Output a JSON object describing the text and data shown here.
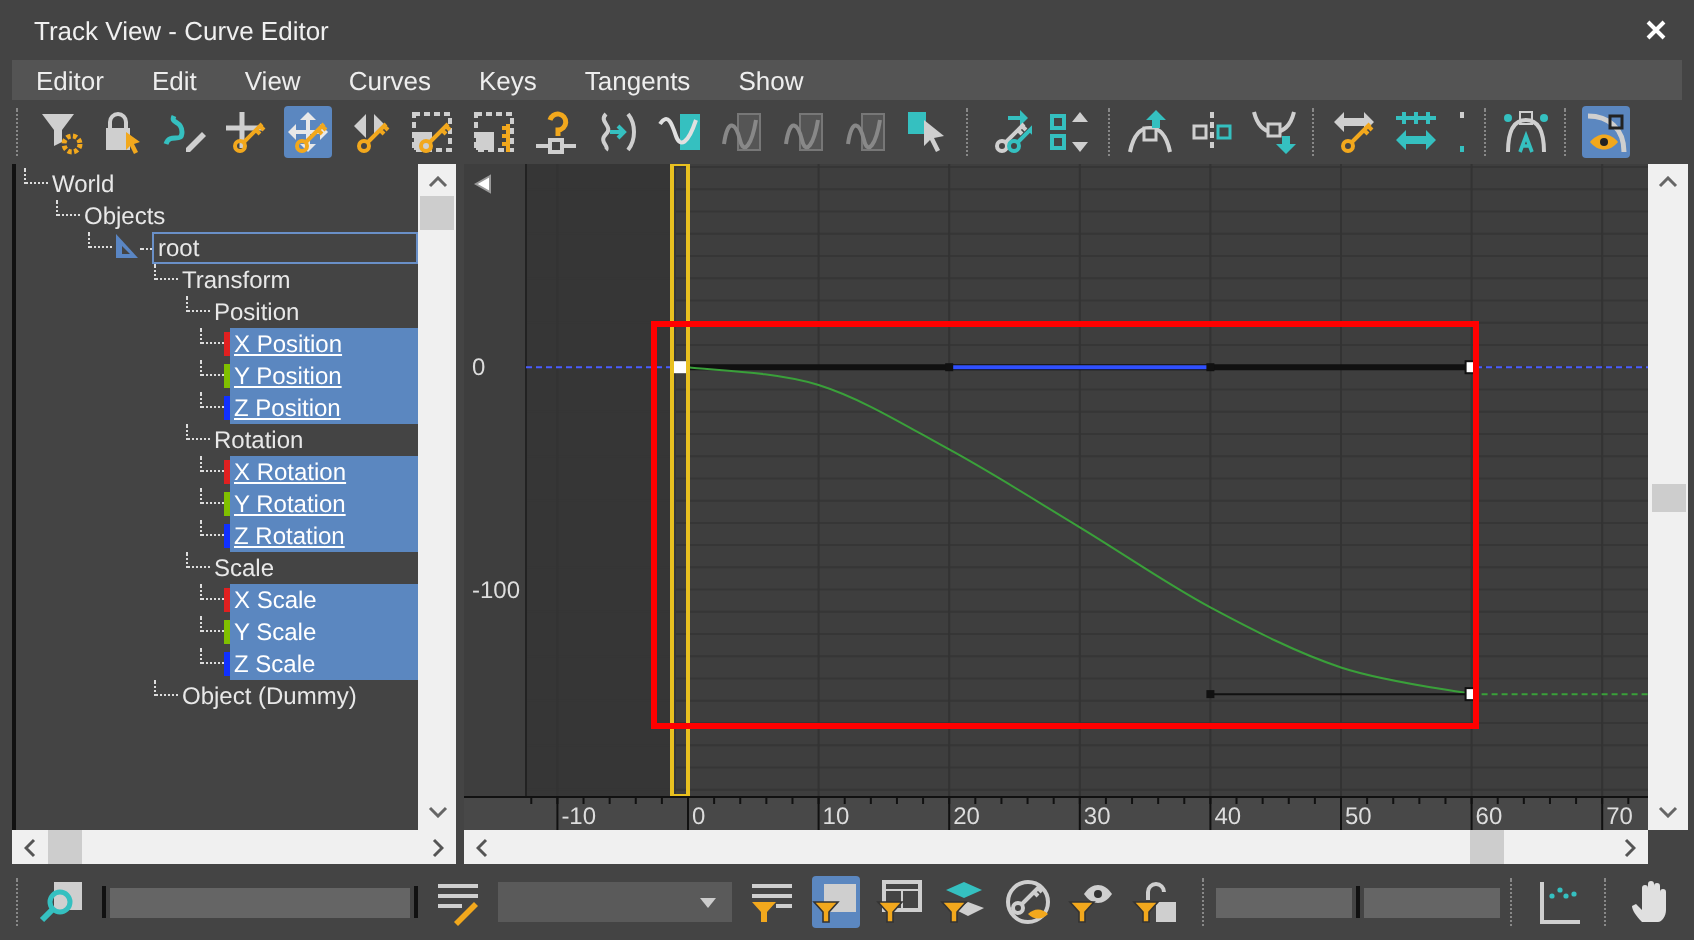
{
  "window": {
    "title": "Track View - Curve Editor"
  },
  "menu": [
    {
      "label": "Editor"
    },
    {
      "label": "Edit"
    },
    {
      "label": "View"
    },
    {
      "label": "Curves"
    },
    {
      "label": "Keys"
    },
    {
      "label": "Tangents"
    },
    {
      "label": "Show"
    }
  ],
  "toolbar": {
    "groups": [
      [
        {
          "selected": false
        },
        {
          "selected": false
        },
        {
          "selected": false
        },
        {
          "selected": false
        },
        {
          "selected": true
        },
        {
          "selected": false
        },
        {
          "selected": false
        },
        {
          "selected": false
        },
        {
          "selected": false
        },
        {
          "selected": false
        },
        {
          "selected": false
        },
        {
          "selected": false
        },
        {
          "selected": false
        },
        {
          "selected": false
        },
        {
          "selected": false
        }
      ],
      [
        {
          "selected": false
        },
        {
          "selected": false
        }
      ],
      [
        {
          "selected": false
        },
        {
          "selected": false
        },
        {
          "selected": false
        }
      ],
      [
        {
          "selected": false
        },
        {
          "selected": false
        },
        {
          "selected": false
        }
      ],
      [
        {
          "selected": false
        }
      ],
      [
        {
          "selected": true
        }
      ]
    ]
  },
  "tree": [
    {
      "label": "World",
      "kind": "node",
      "selected": false,
      "focused": false,
      "children": [
        {
          "label": "Objects",
          "kind": "node",
          "selected": false,
          "focused": false,
          "children": [
            {
              "label": "root",
              "kind": "object",
              "selected": false,
              "focused": true,
              "children": [
                {
                  "label": "Transform",
                  "kind": "node",
                  "selected": false,
                  "focused": false,
                  "children": [
                    {
                      "label": "Position",
                      "kind": "node",
                      "selected": false,
                      "focused": false,
                      "children": [
                        {
                          "label": "X Position",
                          "kind": "track",
                          "color": "#e02020",
                          "selected": true,
                          "focused": false,
                          "animated": true
                        },
                        {
                          "label": "Y Position",
                          "kind": "track",
                          "color": "#80c000",
                          "selected": true,
                          "focused": false,
                          "animated": true
                        },
                        {
                          "label": "Z Position",
                          "kind": "track",
                          "color": "#1030ff",
                          "selected": true,
                          "focused": false,
                          "animated": true
                        }
                      ]
                    },
                    {
                      "label": "Rotation",
                      "kind": "node",
                      "selected": false,
                      "focused": false,
                      "children": [
                        {
                          "label": "X Rotation",
                          "kind": "track",
                          "color": "#e02020",
                          "selected": true,
                          "focused": false,
                          "animated": true
                        },
                        {
                          "label": "Y Rotation",
                          "kind": "track",
                          "color": "#80c000",
                          "selected": true,
                          "focused": false,
                          "animated": true
                        },
                        {
                          "label": "Z Rotation",
                          "kind": "track",
                          "color": "#1030ff",
                          "selected": true,
                          "focused": false,
                          "animated": true
                        }
                      ]
                    },
                    {
                      "label": "Scale",
                      "kind": "node",
                      "selected": false,
                      "focused": false,
                      "children": [
                        {
                          "label": "X Scale",
                          "kind": "track",
                          "color": "#e02020",
                          "selected": true,
                          "focused": false,
                          "animated": false
                        },
                        {
                          "label": "Y Scale",
                          "kind": "track",
                          "color": "#80c000",
                          "selected": true,
                          "focused": false,
                          "animated": false
                        },
                        {
                          "label": "Z Scale",
                          "kind": "track",
                          "color": "#1030ff",
                          "selected": true,
                          "focused": false,
                          "animated": false
                        }
                      ]
                    }
                  ]
                },
                {
                  "label": "Object (Dummy)",
                  "kind": "node",
                  "selected": false,
                  "focused": false
                }
              ]
            }
          ]
        }
      ]
    }
  ],
  "graph": {
    "value_labels": [
      "0",
      "-100"
    ],
    "frame_labels": [
      "-10",
      "0",
      "10",
      "20",
      "30",
      "40",
      "50",
      "60",
      "70"
    ]
  },
  "bottom_toolbar": [
    {
      "selected": false
    },
    {
      "selected": false
    },
    {
      "selected": false
    },
    {
      "selected": true
    },
    {
      "selected": false
    },
    {
      "selected": false
    },
    {
      "selected": false
    },
    {
      "selected": false
    },
    {
      "selected": false
    },
    {
      "selected": false
    },
    {
      "selected": false
    }
  ]
}
